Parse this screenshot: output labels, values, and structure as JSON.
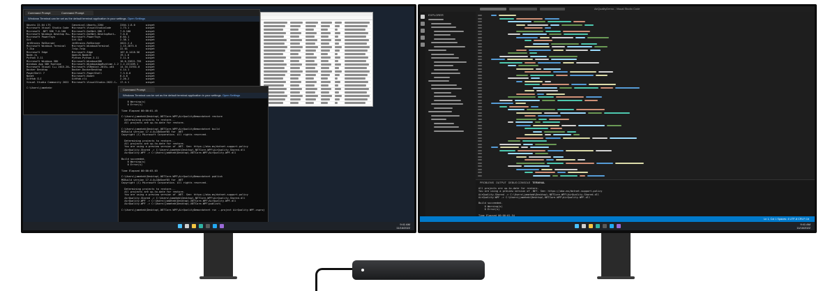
{
  "left_screen": {
    "window_tabs": [
      "Command Prompt",
      "Command Prompt"
    ],
    "banner": {
      "text": "Windows Terminal can be set as the default terminal application in your settings.",
      "link": "Open Settings"
    },
    "upper_terminal_lines": [
      "Ubuntu 22.04 LTS              Canonical.Ubuntu.2204           2204.1.8.0       winget",
      "Microsoft Visual Studio Code  Microsoft.VisualStudioCode      1.73.1           winget",
      "Microsoft .NET SDK 7.0.100    Microsoft.DotNet.SDK.7          7.0.100          winget",
      "Microsoft Windows Desktop Ru… Microsoft.DotNet.DesktopRunt…   7.0.0            winget",
      "Microsoft PowerToys           Microsoft.PowerToys             0.64.1           winget",
      "Git                           Git.Git                         2.38.1           winget",
      "JetBrains ReSharper           JetBrains.ReSharper             2022.2.4         winget",
      "Microsoft Windows Terminal    Microsoft.WindowsTerminal       1.15.2875.0      winget",
      "7-Zip                         7zip.7zip                       22.01            winget",
      "Microsoft Edge                Microsoft.Edge                  107.0.1418.56    winget",
      "Node.js                       OpenJS.NodeJS                   19.1.0           winget",
      "Python 3.11                   Python.Python.3.11              3.11.0           winget",
      "Microsoft Windows SDK         Microsoft.WindowsSDK            10.0.22621.755   winget",
      "Windows App SDK Runtime       Microsoft.WindowsAppRuntime.1.2 1.2.221109.1     winget",
      "Microsoft Visual C++ 2015-20… Microsoft.VCRedist.2015+.x64    14.34.31931.0    winget",
      "Docker Desktop                Docker.DockerDesktop            4.14.1           winget",
      "PowerShell 7                  Microsoft.PowerShell            7.3.0.0          winget",
      "NuGet                         Microsoft.NuGet                 6.4.0            winget",
      "GitHub CLI                    GitHub.cli                      2.20.2           winget",
      "Visual Studio Community 2022  Microsoft.VisualStudio.2022.C…  17.4.1           winget",
      "",
      "C:\\Users\\jameheb>"
    ],
    "lower_terminal_lines": [
      "    0 Warning(s)",
      "    0 Error(s)",
      "",
      "Time Elapsed 00:00:01.45",
      "",
      "C:\\Users\\jameheb\\Desktop\\.NETCore-WPF\\AirQualityDemo>dotnet restore",
      "  Determining projects to restore...",
      "  All projects are up-to-date for restore.",
      "",
      "C:\\Users\\jameheb\\Desktop\\.NETCore-WPF\\AirQualityDemo>dotnet build",
      "MSBuild version 17.4.0+18d5aef85 for .NET",
      "Copyright (C) Microsoft Corporation. All rights reserved.",
      "",
      "  Determining projects to restore...",
      "  All projects are up-to-date for restore.",
      "  You are using a preview version of .NET. See: https://aka.ms/dotnet-support-policy",
      "  AirQuality.Shared -> C:\\Users\\jameheb\\Desktop\\.NETCore-WPF\\AirQuality.Shared.dll",
      "  AirQuality.WPF -> C:\\Users\\jameheb\\Desktop\\.NETCore-WPF\\AirQuality.WPF.dll",
      "",
      "Build succeeded.",
      "    0 Warning(s)",
      "    0 Error(s)",
      "",
      "Time Elapsed 00:00:03.03",
      "",
      "C:\\Users\\jameheb\\Desktop\\.NETCore-WPF\\AirQualityDemo>dotnet publish",
      "MSBuild version 17.4.0+18d5aef85 for .NET",
      "Copyright (C) Microsoft Corporation. All rights reserved.",
      "",
      "  Determining projects to restore...",
      "  All projects are up-to-date for restore.",
      "  You are using a preview version of .NET. See: https://aka.ms/dotnet-support-policy",
      "  AirQuality.Shared -> C:\\Users\\jameheb\\Desktop\\.NETCore-WPF\\AirQuality.Shared.dll",
      "  AirQuality.WPF -> C:\\Users\\jameheb\\Desktop\\.NETCore-WPF\\AirQuality.WPF.dll",
      "  AirQuality.WPF -> C:\\Users\\jameheb\\Desktop\\.NETCore-WPF\\publish\\",
      "",
      "C:\\Users\\jameheb\\Desktop\\.NETCore-WPF\\AirQualityDemo>dotnet run --project AirQuality.WPF.csproj"
    ],
    "taskbar_time": "9:41 AM",
    "taskbar_date": "11/16/2022"
  },
  "right_screen": {
    "title": "AirQualityDemo - Visual Studio Code",
    "explorer_heading": "EXPLORER",
    "panel_tabs": [
      "PROBLEMS",
      "OUTPUT",
      "DEBUG CONSOLE",
      "TERMINAL"
    ],
    "panel_lines": [
      "All projects are up-to-date for restore.",
      "You are using a preview version of .NET. See: https://aka.ms/dotnet-support-policy",
      "AirQuality.Shared -> C:\\Users\\jameheb\\Desktop\\.NETCore-WPF\\AirQuality.Shared.dll",
      "AirQuality.WPF -> C:\\Users\\jameheb\\Desktop\\.NETCore-WPF\\AirQuality.WPF.dll",
      "",
      "Build succeeded.",
      "    0 Warning(s)",
      "    0 Error(s)",
      "",
      "Time Elapsed 00:00:01.54",
      "PS C:\\Users\\jameheb\\Desktop\\.NETCore-WPF\\AirQualityDemo>"
    ],
    "status_text": "Ln 1, Col 1   Spaces: 4   UTF-8   CRLF   C#",
    "taskbar_time": "9:41 AM",
    "taskbar_date": "11/16/2022"
  },
  "colors": {
    "vscode_blue": "#007acc",
    "code_keyword": "#569cd6",
    "code_type": "#4ec9b0",
    "code_string": "#ce9178",
    "code_method": "#dcdcaa",
    "code_variable": "#9cdcfe",
    "code_comment": "#6a9955"
  }
}
